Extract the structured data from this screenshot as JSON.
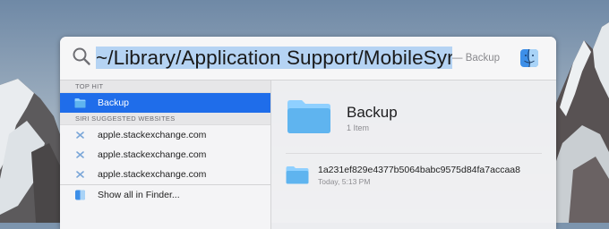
{
  "search": {
    "query": "~/Library/Application Support/MobileSync/Ba",
    "suffix": "— Backup"
  },
  "sections": {
    "top_hit": "TOP HIT",
    "siri": "SIRI SUGGESTED WEBSITES"
  },
  "top_hit": {
    "label": "Backup"
  },
  "websites": [
    {
      "label": "apple.stackexchange.com"
    },
    {
      "label": "apple.stackexchange.com"
    },
    {
      "label": "apple.stackexchange.com"
    }
  ],
  "show_all": {
    "label": "Show all in Finder..."
  },
  "preview": {
    "title": "Backup",
    "subtitle": "1 Item",
    "item": {
      "name": "1a231ef829e4377b5064babc9575d84fa7accaa8",
      "meta": "Today, 5:13 PM"
    }
  },
  "colors": {
    "selection": "#1f6dea",
    "highlight": "#b5d3f3",
    "folder": "#5fb4ef"
  }
}
